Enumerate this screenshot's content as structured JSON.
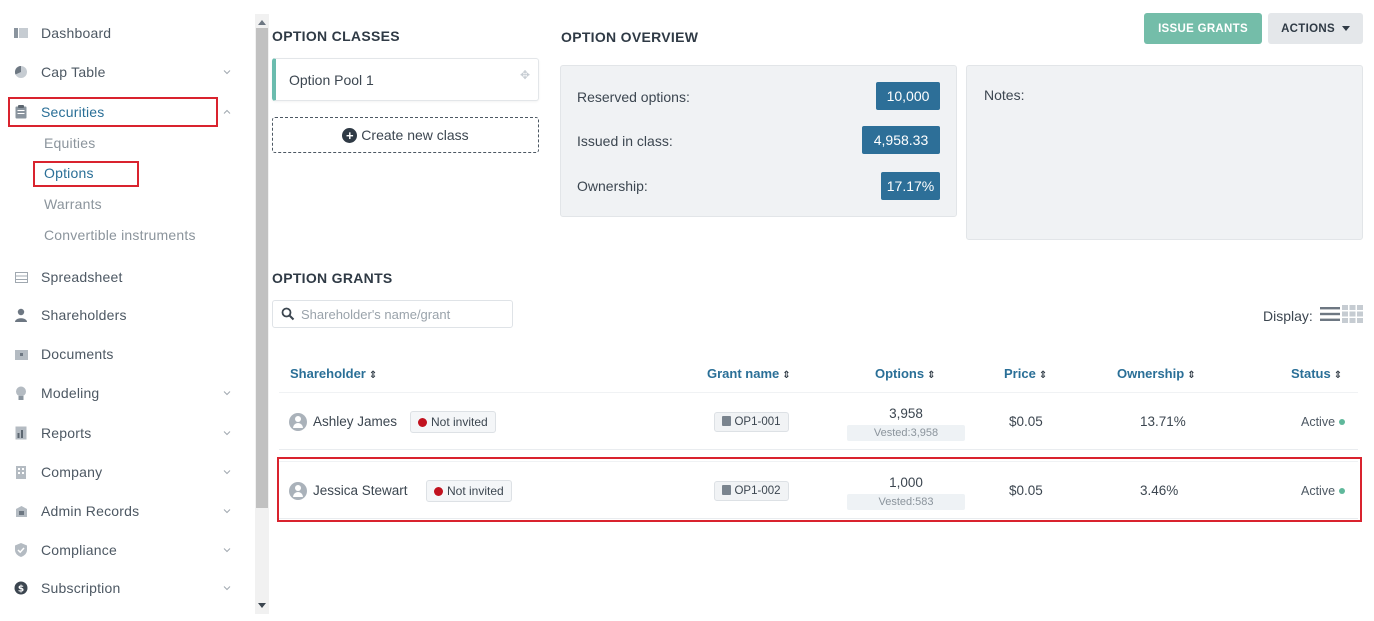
{
  "sidebar": {
    "items": [
      {
        "label": "Dashboard",
        "icon": "dashboard-icon",
        "chevron": false
      },
      {
        "label": "Cap Table",
        "icon": "pie-chart-icon",
        "chevron": true
      },
      {
        "label": "Securities",
        "icon": "clipboard-icon",
        "chevron": true,
        "active": true
      },
      {
        "label": "Spreadsheet",
        "icon": "table-icon",
        "chevron": false
      },
      {
        "label": "Shareholders",
        "icon": "user-icon",
        "chevron": false
      },
      {
        "label": "Documents",
        "icon": "folder-icon",
        "chevron": false
      },
      {
        "label": "Modeling",
        "icon": "lightbulb-icon",
        "chevron": true
      },
      {
        "label": "Reports",
        "icon": "report-icon",
        "chevron": true
      },
      {
        "label": "Company",
        "icon": "building-icon",
        "chevron": true
      },
      {
        "label": "Admin Records",
        "icon": "admin-icon",
        "chevron": true
      },
      {
        "label": "Compliance",
        "icon": "shield-check-icon",
        "chevron": true
      },
      {
        "label": "Subscription",
        "icon": "dollar-circle-icon",
        "chevron": true
      }
    ],
    "securities_sub": [
      {
        "label": "Equities"
      },
      {
        "label": "Options",
        "active": true
      },
      {
        "label": "Warrants"
      },
      {
        "label": "Convertible instruments"
      }
    ]
  },
  "option_classes": {
    "heading": "OPTION CLASSES",
    "classes": [
      {
        "name": "Option Pool 1"
      }
    ],
    "create_label": "Create new class"
  },
  "overview": {
    "heading": "OPTION OVERVIEW",
    "reserved_label": "Reserved options:",
    "reserved_value": "10,000",
    "issued_label": "Issued in class:",
    "issued_value": "4,958.33",
    "ownership_label": "Ownership:",
    "ownership_value": "17.17%",
    "notes_label": "Notes:"
  },
  "toolbar": {
    "issue_grants_label": "ISSUE GRANTS",
    "actions_label": "ACTIONS"
  },
  "grants": {
    "heading": "OPTION GRANTS",
    "search_placeholder": "Shareholder's name/grant",
    "display_label": "Display:",
    "columns": {
      "shareholder": "Shareholder",
      "grant_name": "Grant name",
      "options": "Options",
      "price": "Price",
      "ownership": "Ownership",
      "status": "Status"
    },
    "rows": [
      {
        "shareholder": "Ashley James",
        "invite_status": "Not invited",
        "grant": "OP1-001",
        "options": "3,958",
        "vested": "Vested:3,958",
        "price": "$0.05",
        "ownership": "13.71%",
        "status": "Active"
      },
      {
        "shareholder": "Jessica Stewart",
        "invite_status": "Not invited",
        "grant": "OP1-002",
        "options": "1,000",
        "vested": "Vested:583",
        "price": "$0.05",
        "ownership": "3.46%",
        "status": "Active"
      }
    ]
  },
  "colors": {
    "accent_blue": "#2d6f98",
    "teal": "#74bda9",
    "highlight_red": "#d9232e",
    "not_invited_red": "#c1121f",
    "active_green": "#5fb89b"
  }
}
